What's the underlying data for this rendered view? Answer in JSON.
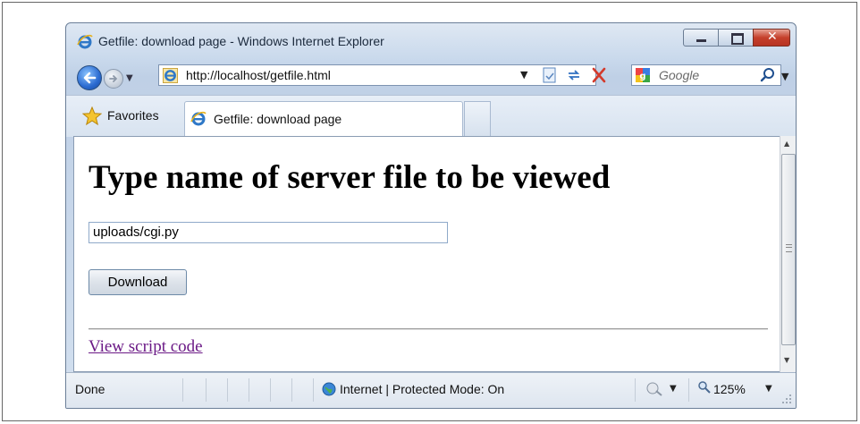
{
  "window": {
    "title": "Getfile: download page - Windows Internet Explorer",
    "controls": [
      "minimize",
      "maximize",
      "close"
    ]
  },
  "toolbar": {
    "address": "http://localhost/getfile.html",
    "search_placeholder": "Google"
  },
  "tabs": {
    "favorites_label": "Favorites",
    "active_tab_label": "Getfile: download page"
  },
  "page": {
    "heading": "Type name of server file to be viewed",
    "filename_value": "uploads/cgi.py",
    "download_label": "Download",
    "link_label": "View script code"
  },
  "statusbar": {
    "status_text": "Done",
    "zone_text": "Internet | Protected Mode: On",
    "zoom_text": "125%"
  },
  "icons": [
    "ie-logo-icon",
    "back-icon",
    "forward-icon",
    "refresh-icon",
    "stop-icon",
    "compat-view-icon",
    "google-icon",
    "search-icon",
    "favorites-star-icon",
    "globe-icon",
    "protected-mode-icon",
    "zoom-icon"
  ],
  "colors": {
    "link_visited": "#6b1a86",
    "close_button": "#c5402c",
    "back_button": "#2a6ad0"
  }
}
